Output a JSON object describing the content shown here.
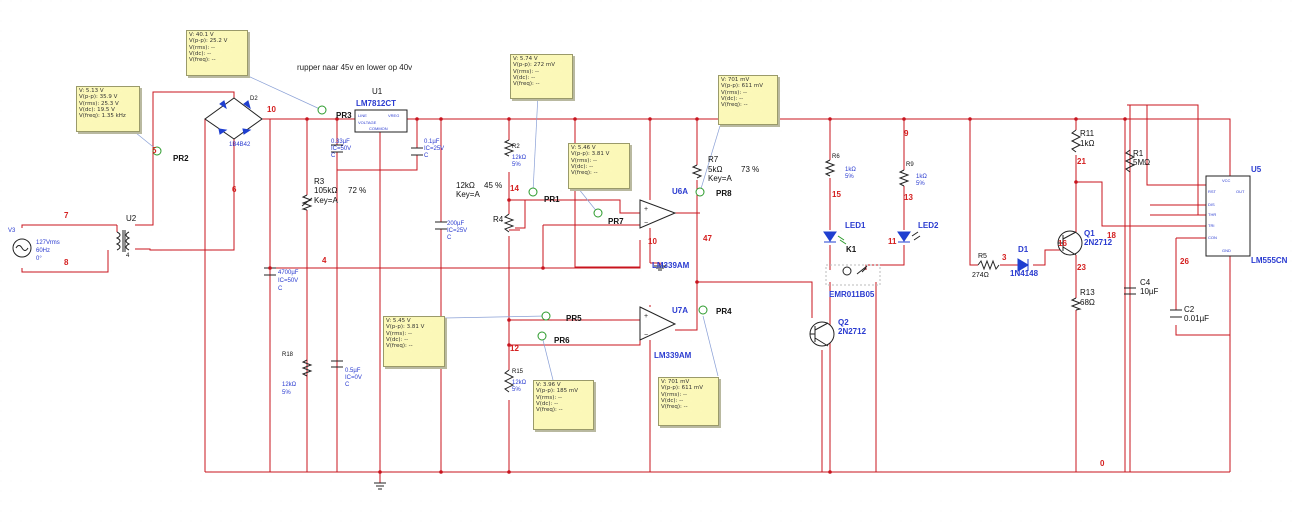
{
  "note": "rupper naar 45v en lower op 40v",
  "colors": {
    "wire": "#c8141e",
    "part": "#222222",
    "label_blue": "#2a3bd0",
    "refdes": "#111111",
    "net": "#d41e1e",
    "probe_bg": "#fbf8b8",
    "probe_line": "#7b8fc8",
    "probe_green": "#2a9a2a",
    "led": "#1f3fd0"
  },
  "probes": {
    "pr1": {
      "label": "PR1",
      "lines": [
        "V: 40.1 V",
        "V(p-p): 25.2 V",
        "V(rms): --",
        "V(dc): --",
        "V(freq): --"
      ]
    },
    "pr2": {
      "label": "PR2",
      "lines": [
        "V: 5.13 V",
        "V(p-p): 35.9 V",
        "V(rms): 25.3 V",
        "V(dc): 19.5 V",
        "V(freq): 1.35 kHz"
      ]
    },
    "pr3": {
      "label": "PR3"
    },
    "pr5top": {
      "lines": [
        "V: 5.74 V",
        "V(p-p): 272 mV",
        "V(rms): --",
        "V(dc): --",
        "V(freq): --"
      ]
    },
    "pr7": {
      "label": "PR7",
      "lines": [
        "V: 5.46 V",
        "V(p-p): 3.81 V",
        "V(rms): --",
        "V(dc): --",
        "V(freq): --"
      ]
    },
    "pr8": {
      "label": "PR8",
      "lines": [
        "V: 701 mV",
        "V(p-p): 611 mV",
        "V(rms): --",
        "V(dc): --",
        "V(freq): --"
      ]
    },
    "pr5": {
      "label": "PR5",
      "lines": [
        "V: 5.45 V",
        "V(p-p): 3.81 V",
        "V(rms): --",
        "V(dc): --",
        "V(freq): --"
      ]
    },
    "pr6": {
      "label": "PR6",
      "lines": [
        "V: 3.96 V",
        "V(p-p): 185 mV",
        "V(rms): --",
        "V(dc): --",
        "V(freq): --"
      ]
    },
    "pr4": {
      "label": "PR4",
      "lines": [
        "V: 701 mV",
        "V(p-p): 611 mV",
        "V(rms): --",
        "V(dc): --",
        "V(freq): --"
      ]
    }
  },
  "parts": {
    "v3": {
      "ref": "V3",
      "v1": "127Vrms",
      "v2": "60Hz",
      "v3": "0°"
    },
    "u2": {
      "ref": "U2",
      "pin": "4"
    },
    "d2": {
      "ref": "D2",
      "val": "1B4B42"
    },
    "u1": {
      "ref": "U1",
      "val": "LM7812CT",
      "pin_in": "LINE",
      "pin_out": "VREG",
      "pin_common": "COMMON",
      "pin_volt": "VOLTAGE"
    },
    "c_033": {
      "v1": "0.33µF",
      "v2": "IC=50V",
      "v3": "C"
    },
    "c_01": {
      "v1": "0.1µF",
      "v2": "IC=25V",
      "v3": "C"
    },
    "r3": {
      "ref": "R3",
      "val": "105kΩ",
      "pct": "72 %",
      "key": "Key=A"
    },
    "c_4700": {
      "v1": "4700µF",
      "v2": "IC=50V",
      "v3": "C"
    },
    "r18": {
      "ref": "R18",
      "val": "12kΩ",
      "tol": "5%"
    },
    "c_05": {
      "v1": "0.5µF",
      "v2": "IC=0V",
      "v3": "C"
    },
    "c_200": {
      "v1": "200µF",
      "v2": "IC=25V",
      "v3": "C"
    },
    "r2": {
      "ref": "R2",
      "val": "12kΩ",
      "tol": "5%"
    },
    "r4": {
      "ref": "R4",
      "val": "12kΩ",
      "pct": "45 %",
      "key": "Key=A"
    },
    "r15": {
      "ref": "R15",
      "val": "12kΩ",
      "tol": "5%"
    },
    "u6a": {
      "ref": "U6A",
      "val": "LM339AM"
    },
    "u7a": {
      "ref": "U7A",
      "val": "LM339AM"
    },
    "r7": {
      "ref": "R7",
      "val": "5kΩ",
      "pct": "73 %",
      "key": "Key=A"
    },
    "r6": {
      "ref": "R6",
      "val": "1kΩ",
      "tol": "5%"
    },
    "r9": {
      "ref": "R9",
      "val": "1kΩ",
      "tol": "5%"
    },
    "led1": {
      "ref": "LED1"
    },
    "led2": {
      "ref": "LED2"
    },
    "k1": {
      "ref": "K1",
      "val": "EMR011B05"
    },
    "q2": {
      "ref": "Q2",
      "val": "2N2712"
    },
    "r5": {
      "ref": "R5",
      "val": "274Ω"
    },
    "d1": {
      "ref": "D1",
      "val": "1N4148"
    },
    "q1": {
      "ref": "Q1",
      "val": "2N2712"
    },
    "r11": {
      "ref": "R11",
      "val": "1kΩ"
    },
    "r13": {
      "ref": "R13",
      "val": "68Ω"
    },
    "r1": {
      "ref": "R1",
      "val": "5MΩ"
    },
    "c4": {
      "ref": "C4",
      "val": "10µF"
    },
    "c2": {
      "ref": "C2",
      "val": "0.01µF"
    },
    "u5": {
      "ref": "U5",
      "val": "LM555CN",
      "pins": [
        "VCC",
        "RST",
        "OUT",
        "DIS",
        "THR",
        "TRI",
        "CON",
        "GND"
      ]
    }
  },
  "nets": [
    "7",
    "8",
    "5",
    "6",
    "10",
    "4",
    "14",
    "12",
    "47",
    "10",
    "15",
    "9",
    "13",
    "11",
    "16",
    "3",
    "21",
    "18",
    "23",
    "26",
    "0"
  ]
}
